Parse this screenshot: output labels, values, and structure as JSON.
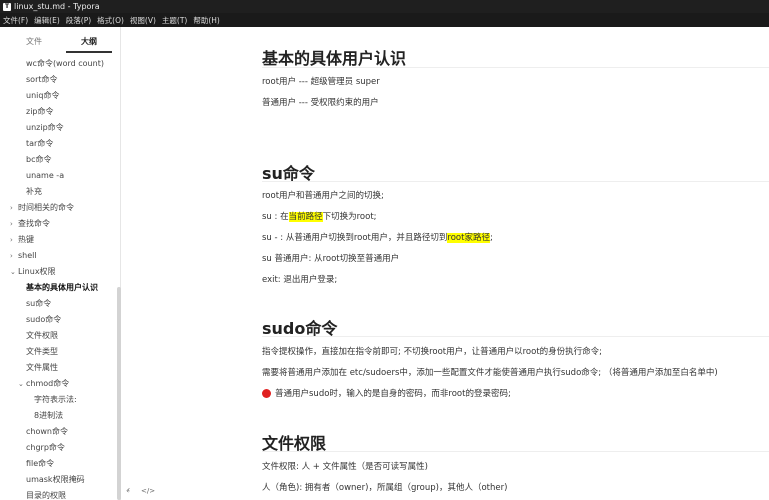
{
  "window": {
    "title": "linux_stu.md - Typora",
    "app_icon": "T"
  },
  "menu": [
    "文件(F)",
    "编辑(E)",
    "段落(P)",
    "格式(O)",
    "视图(V)",
    "主题(T)",
    "帮助(H)"
  ],
  "sidebar": {
    "tab_files": "文件",
    "tab_outline": "大纲",
    "items": [
      {
        "label": "wc命令(word count)"
      },
      {
        "label": "sort命令"
      },
      {
        "label": "uniq命令"
      },
      {
        "label": "zip命令"
      },
      {
        "label": "unzip命令"
      },
      {
        "label": "tar命令"
      },
      {
        "label": "bc命令"
      },
      {
        "label": "uname -a"
      },
      {
        "label": "补充"
      },
      {
        "label": "时间相关的命令",
        "caret": "›"
      },
      {
        "label": "查找命令",
        "caret": "›"
      },
      {
        "label": "热键",
        "caret": "›"
      },
      {
        "label": "shell",
        "caret": "›"
      },
      {
        "label": "Linux权限",
        "caret": "⌄"
      },
      {
        "label": "基本的具体用户认识"
      },
      {
        "label": "su命令"
      },
      {
        "label": "sudo命令"
      },
      {
        "label": "文件权限"
      },
      {
        "label": "文件类型"
      },
      {
        "label": "文件属性"
      },
      {
        "label": "chmod命令",
        "caret": "⌄"
      },
      {
        "label": "字符表示法:"
      },
      {
        "label": "8进制法"
      },
      {
        "label": "chown命令"
      },
      {
        "label": "chgrp命令"
      },
      {
        "label": "file命令"
      },
      {
        "label": "umask权限掩码"
      },
      {
        "label": "目录的权限"
      }
    ],
    "bottom_left_icon": "‹",
    "bottom_code_icon": "</>"
  },
  "content": {
    "s1_title": "基本的具体用户认识",
    "s1_p1": "root用户 --- 超级管理员 super",
    "s1_p2": "普通用户 --- 受权限约束的用户",
    "s2_title": "su命令",
    "s2_p1": "root用户和普通用户之间的切换;",
    "s2_p2_a": "su : 在",
    "s2_p2_mark": "当前路径",
    "s2_p2_b": "下切换为root;",
    "s2_p3_a": "su - : 从普通用户切换到root用户，并且路径切到",
    "s2_p3_mark": "root家路径",
    "s2_p3_b": ";",
    "s2_p4": "su 普通用户: 从root切换至普通用户",
    "s2_p5": "exit: 退出用户登录;",
    "s3_title": "sudo命令",
    "s3_p1": "指令提权操作，直接加在指令前即可; 不切换root用户，让普通用户以root的身份执行命令;",
    "s3_p2": "需要将普通用户添加在 etc/sudoers中，添加一些配置文件才能使普通用户执行sudo命令; （将普通用户添加至白名单中)",
    "s3_p3": "普通用户sudo时，输入的是自身的密码，而非root的登录密码;",
    "s4_title": "文件权限",
    "s4_p1": "文件权限: 人 +  文件属性（是否可读写属性)",
    "s4_p2": "人（角色): 拥有者（owner)，所属组（group)，其他人（other)"
  }
}
